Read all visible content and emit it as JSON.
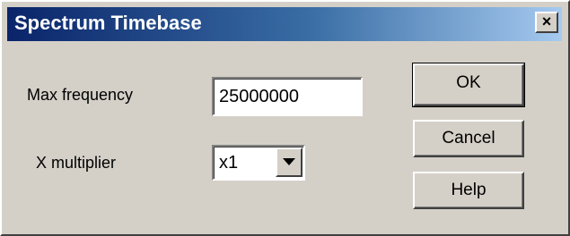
{
  "window": {
    "title": "Spectrum Timebase",
    "close_label": "×"
  },
  "form": {
    "max_frequency": {
      "label": "Max frequency",
      "value": "25000000"
    },
    "x_multiplier": {
      "label": "X multiplier",
      "selected": "x1"
    }
  },
  "buttons": {
    "ok_label": "OK",
    "cancel_label": "Cancel",
    "help_label": "Help"
  },
  "colors": {
    "face": "#d4d0c8",
    "title_start": "#0a246a",
    "title_end": "#a6caf0"
  }
}
